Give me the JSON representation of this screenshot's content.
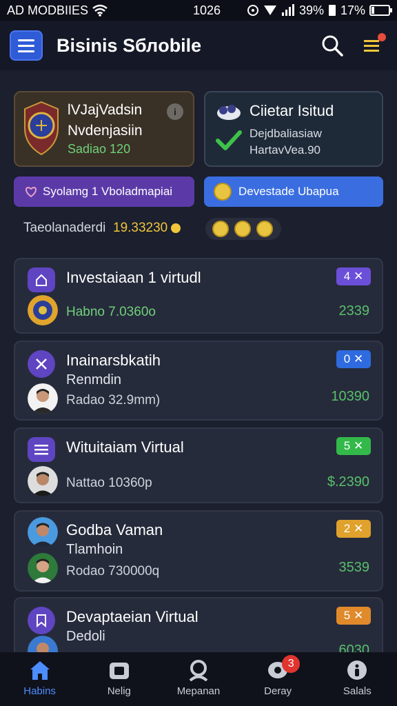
{
  "status_bar": {
    "carrier": "AD MODBIIES",
    "time": "1026",
    "signal_percent": "39%",
    "battery_percent": "17%",
    "battery_level": 0.17
  },
  "header": {
    "title": "Bisinis Sблobile",
    "search_icon": "search-icon",
    "menu_icon": "hamburger-icon",
    "notifications_icon": "list-menu-icon"
  },
  "cards": {
    "profile": {
      "line1": "lVJajVadsin",
      "line2": "Nvdenjasiin",
      "line3": "Sadiao 120",
      "info_label": "i"
    },
    "status": {
      "title": "Ciietar Isitud",
      "line1": "Dejdbaliasiaw",
      "line2": "HartavVeа.90"
    }
  },
  "pills": {
    "left": "Syolamg 1 Vboladmapiai",
    "right": "Devestade Ubapua"
  },
  "balance": {
    "label": "Taeolanaderdi",
    "value": "19.33230"
  },
  "list": [
    {
      "title": "Investaiaan 1 virtudl",
      "meta": "Habno 7.0360o",
      "amount": "2339",
      "badge": "4 ✕",
      "badge_color": "#6b4fd8"
    },
    {
      "title": "Inainarsbkatih",
      "sub": "Renmdin",
      "meta": "Radao 32.9mm)",
      "amount": "10390",
      "badge": "0 ✕",
      "badge_color": "#2f6be0"
    },
    {
      "title": "Wituitaiam Virtual",
      "meta": "Nattao 10360p",
      "amount": "$.2390",
      "badge": "5 ✕",
      "badge_color": "#33b94a"
    },
    {
      "title": "Godba Vaman",
      "sub": "Tlamhoin",
      "meta": "Rodao 730000q",
      "amount": "3539",
      "badge": "2 ✕",
      "badge_color": "#e0a22c"
    },
    {
      "title": "Devaptaeian Virtual",
      "sub": "Dedoli",
      "amount": "6030",
      "badge": "5 ✕",
      "badge_color": "#e08a2c"
    }
  ],
  "bottom_nav": [
    {
      "label": "Habins",
      "icon": "home-icon",
      "active": true
    },
    {
      "label": "Nelig",
      "icon": "camera-icon",
      "active": false
    },
    {
      "label": "Mepanan",
      "icon": "profile-icon",
      "active": false
    },
    {
      "label": "Deray",
      "icon": "chat-icon",
      "active": false,
      "badge": "3"
    },
    {
      "label": "Salals",
      "icon": "info-icon",
      "active": false
    }
  ]
}
